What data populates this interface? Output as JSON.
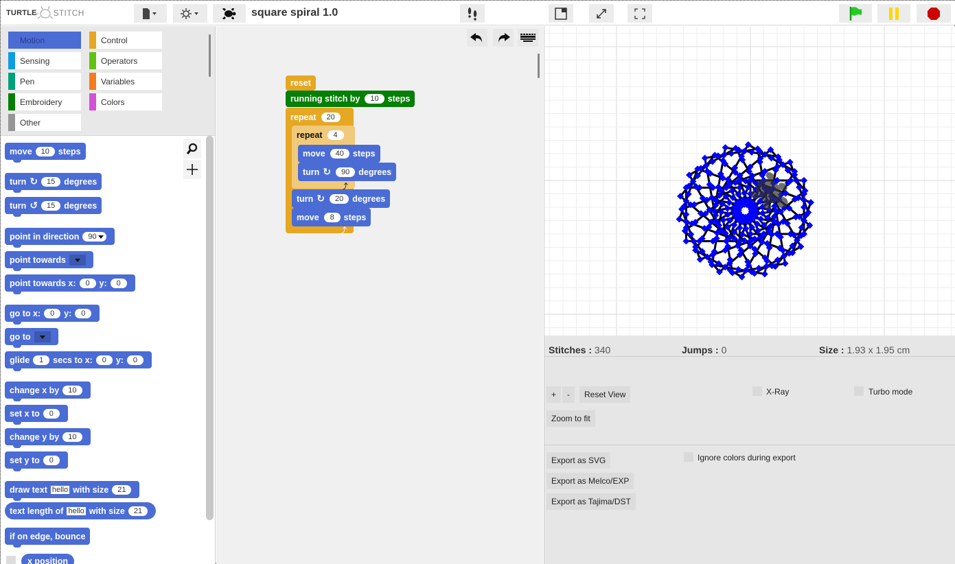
{
  "app": {
    "logo_left": "TURTLE",
    "logo_right": "STITCH",
    "project_title": "square spiral 1.0"
  },
  "toolbar": {
    "file_menu_icon": "file-icon",
    "settings_menu_icon": "gear-icon",
    "sprite_icon": "turtle-icon",
    "step_icon": "footprints-icon",
    "stage_size_icon": "normal-stage-icon",
    "zoom_stage_icon": "expand-icon",
    "fullscreen_icon": "fullscreen-icon",
    "run_icon": "green-flag-icon",
    "pause_icon": "pause-icon",
    "stop_icon": "stop-icon",
    "colors": {
      "flag": "#22cc22",
      "pause": "#ffd700",
      "stop": "#cc0000"
    }
  },
  "palette": {
    "categories": [
      {
        "label": "Motion",
        "color": "#4a6cd4",
        "selected": true
      },
      {
        "label": "Control",
        "color": "#e6a723"
      },
      {
        "label": "Sensing",
        "color": "#0f9ce5"
      },
      {
        "label": "Operators",
        "color": "#62c213"
      },
      {
        "label": "Pen",
        "color": "#00a178"
      },
      {
        "label": "Variables",
        "color": "#f37d1f"
      },
      {
        "label": "Embroidery",
        "color": "#057f05"
      },
      {
        "label": "Colors",
        "color": "#d450d4"
      },
      {
        "label": "Other",
        "color": "#969696"
      }
    ],
    "blocks": {
      "move": {
        "pre": "move",
        "val": "10",
        "post": "steps"
      },
      "turn_cw": {
        "pre": "turn",
        "val": "15",
        "post": "degrees"
      },
      "turn_ccw": {
        "pre": "turn",
        "val": "15",
        "post": "degrees"
      },
      "point_dir": {
        "pre": "point in direction",
        "val": "90"
      },
      "point_towards": {
        "pre": "point towards"
      },
      "point_xy": {
        "pre": "point towards x:",
        "x": "0",
        "ylabel": "y:",
        "y": "0"
      },
      "goto_xy": {
        "pre": "go to x:",
        "x": "0",
        "ylabel": "y:",
        "y": "0"
      },
      "goto": {
        "pre": "go to"
      },
      "glide": {
        "pre": "glide",
        "secs": "1",
        "mid": "secs to x:",
        "x": "0",
        "ylabel": "y:",
        "y": "0"
      },
      "change_x": {
        "pre": "change x by",
        "val": "10"
      },
      "set_x": {
        "pre": "set x to",
        "val": "0"
      },
      "change_y": {
        "pre": "change y by",
        "val": "10"
      },
      "set_y": {
        "pre": "set y to",
        "val": "0"
      },
      "draw_text": {
        "pre": "draw text",
        "text": "hello",
        "mid": "with size",
        "size": "21"
      },
      "text_length": {
        "pre": "text length of",
        "text": "hello",
        "mid": "with size",
        "size": "21"
      },
      "bounce": {
        "pre": "if on edge, bounce"
      },
      "x_position": {
        "pre": "x position"
      }
    }
  },
  "script": {
    "undo_icon": "undo-icon",
    "redo_icon": "redo-icon",
    "keyboard_icon": "keyboard-icon",
    "reset": "reset",
    "running_stitch": {
      "pre": "running stitch by",
      "val": "10",
      "post": "steps"
    },
    "repeat_outer": {
      "pre": "repeat",
      "val": "20"
    },
    "repeat_inner": {
      "pre": "repeat",
      "val": "4"
    },
    "move_inner": {
      "pre": "move",
      "val": "40",
      "post": "steps"
    },
    "turn_inner": {
      "pre": "turn",
      "val": "90",
      "post": "degrees"
    },
    "turn_outer": {
      "pre": "turn",
      "val": "20",
      "post": "degrees"
    },
    "move_outer": {
      "pre": "move",
      "val": "8",
      "post": "steps"
    }
  },
  "stage": {
    "stitch_color": "#0000ff",
    "line_color": "#000000"
  },
  "info": {
    "stitches_label": "Stitches :",
    "stitches": "340",
    "jumps_label": "Jumps :",
    "jumps": "0",
    "size_label": "Size :",
    "size": "1.93 x 1.95 cm",
    "zoom_in": "+",
    "zoom_out": "-",
    "reset_view": "Reset View",
    "zoom_fit": "Zoom to fit",
    "xray": "X-Ray",
    "turbo": "Turbo mode",
    "export_svg": "Export as SVG",
    "export_exp": "Export as Melco/EXP",
    "export_dst": "Export as Tajima/DST",
    "ignore_colors": "Ignore colors during export"
  }
}
